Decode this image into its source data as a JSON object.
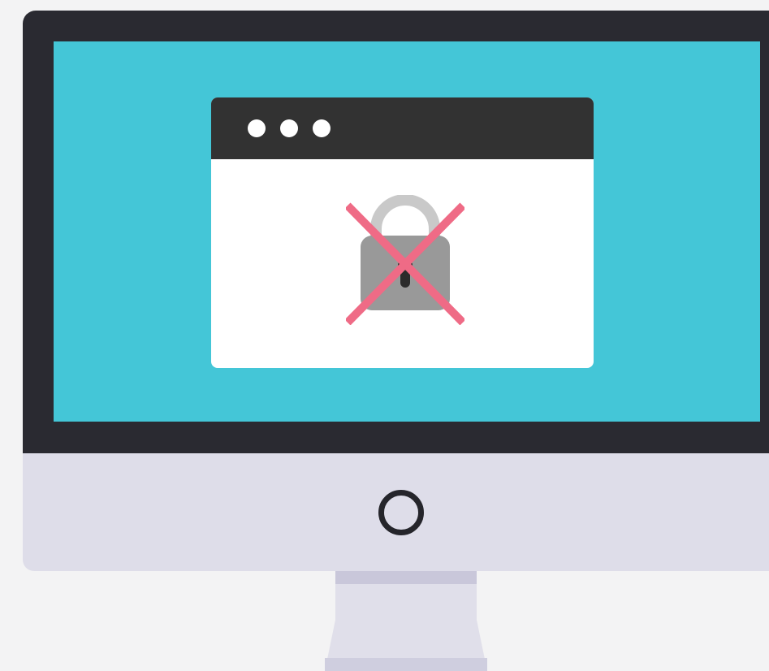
{
  "icons": {
    "monitor": "monitor-icon",
    "browser": "browser-window-icon",
    "lock": "padlock-icon",
    "cross": "cross-icon",
    "power": "power-button-icon"
  },
  "colors": {
    "background": "#f3f3f4",
    "bezel": "#2a2a31",
    "screen": "#44c6d7",
    "chin": "#dedde9",
    "browser_titlebar": "#323232",
    "browser_body": "#ffffff",
    "lock_body": "#999999",
    "lock_shackle": "#c9c9c9",
    "cross": "#ef6b86"
  },
  "browser": {
    "window_dots": 3
  }
}
